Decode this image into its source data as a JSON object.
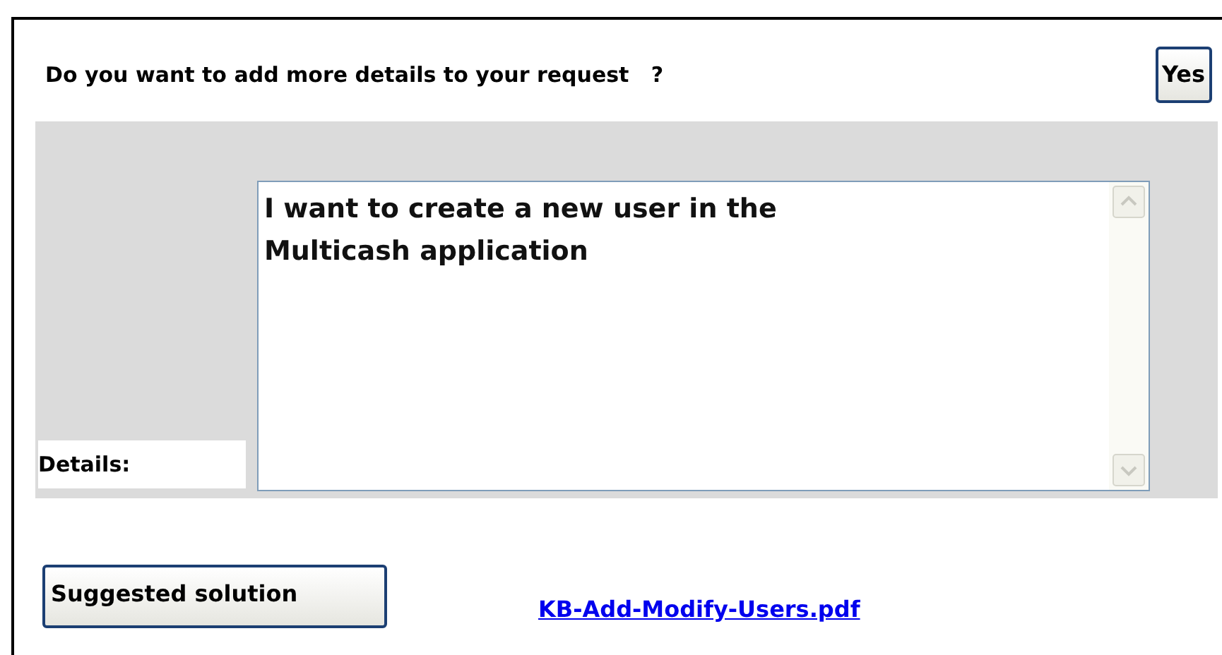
{
  "question": "Do you want to add more details to your request   ?",
  "yes_button": "Yes",
  "details": {
    "label": "Details:",
    "value": "I want to create a new user in the\nMulticash application"
  },
  "suggested_button": "Suggested solution",
  "link": "KB-Add-Modify-Users.pdf"
}
